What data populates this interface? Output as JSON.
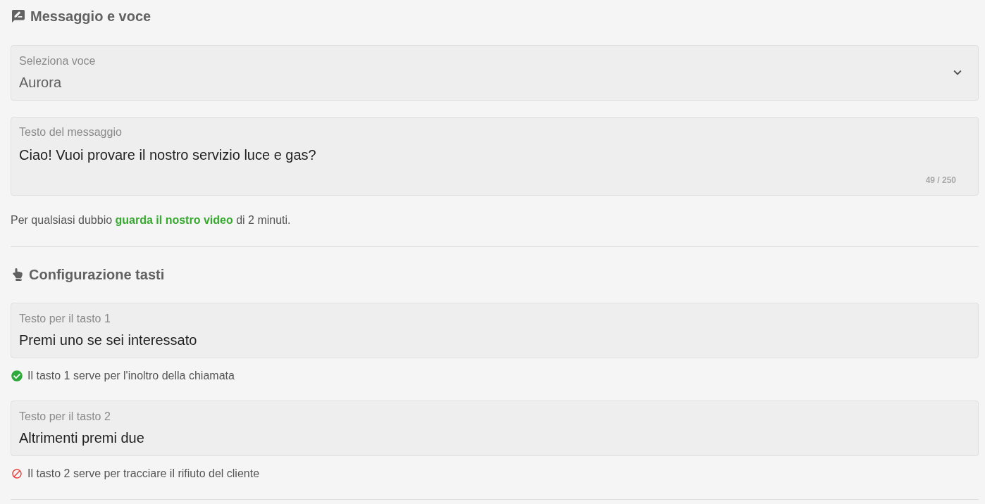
{
  "message_section": {
    "title": "Messaggio e voce",
    "voice_select": {
      "label": "Seleziona voce",
      "value": "Aurora"
    },
    "message_field": {
      "label": "Testo del messaggio",
      "value": "Ciao! Vuoi provare il nostro servizio luce e gas?",
      "counter": "49 / 250"
    },
    "help": {
      "before": "Per qualsiasi dubbio",
      "link": "guarda il nostro video",
      "after": "di 2 minuti."
    }
  },
  "keys_section": {
    "title": "Configurazione tasti",
    "keys": [
      {
        "label": "Testo per il tasto 1",
        "value": "Premi uno se sei interessato",
        "hint": {
          "kind": "success",
          "text": "Il tasto 1 serve per l'inoltro della chiamata"
        }
      },
      {
        "label": "Testo per il tasto 2",
        "value": "Altrimenti premi due",
        "hint": {
          "kind": "error",
          "text": "Il tasto 2 serve per tracciare il rifiuto del cliente"
        }
      }
    ]
  }
}
